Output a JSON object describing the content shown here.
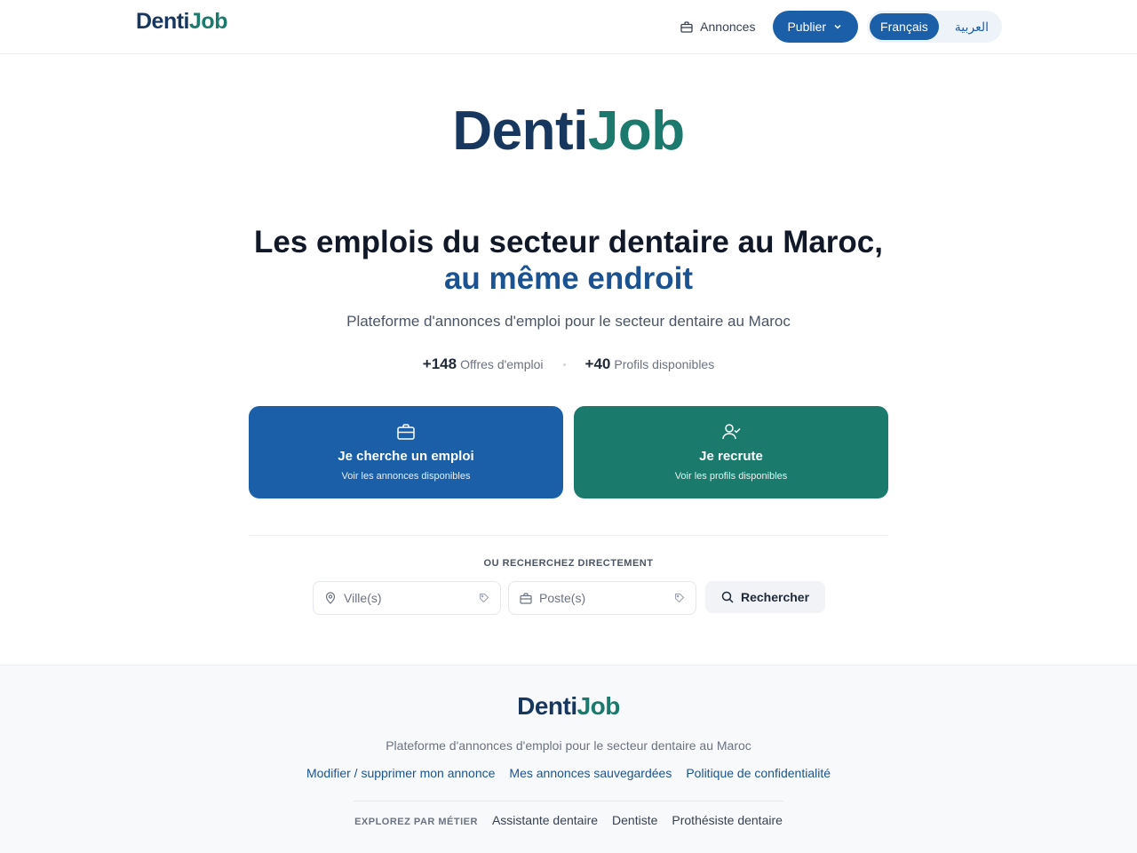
{
  "brand": {
    "name_part1": "Denti",
    "name_part2": "Jo",
    "name_part3": "b",
    "primary_color": "#1b5fa8",
    "secondary_color": "#1a7a6c",
    "dark_color": "#17375e"
  },
  "header": {
    "nav_listings": "Annonces",
    "publish_label": "Publier",
    "lang_french": "Français",
    "lang_arabic": "العربية"
  },
  "hero": {
    "headline_line1": "Les emplois du secteur dentaire au Maroc,",
    "headline_line2": "au même endroit",
    "subtitle": "Plateforme d'annonces d'emploi pour le secteur dentaire au Maroc",
    "stats": [
      {
        "value": "+148",
        "label": "Offres d'emploi"
      },
      {
        "value": "+40",
        "label": "Profils disponibles"
      }
    ]
  },
  "cta": {
    "seek": {
      "title": "Je cherche un emploi",
      "subtitle": "Voir les annonces disponibles",
      "icon": "briefcase-icon"
    },
    "hire": {
      "title": "Je recrute",
      "subtitle": "Voir les profils disponibles",
      "icon": "user-check-icon"
    }
  },
  "search": {
    "label": "OU RECHERCHEZ DIRECTEMENT",
    "city_placeholder": "Ville(s)",
    "position_placeholder": "Poste(s)",
    "button_label": "Rechercher"
  },
  "footer": {
    "tagline": "Plateforme d'annonces d'emploi pour le secteur dentaire au Maroc",
    "links": [
      "Modifier / supprimer mon annonce",
      "Mes annonces sauvegardées",
      "Politique de confidentialité"
    ],
    "explore_label": "EXPLOREZ PAR MÉTIER",
    "professions": [
      "Assistante dentaire",
      "Dentiste",
      "Prothésiste dentaire"
    ]
  }
}
